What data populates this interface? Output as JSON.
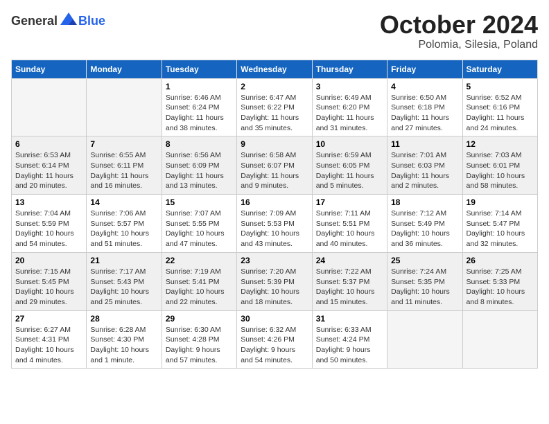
{
  "header": {
    "logo_general": "General",
    "logo_blue": "Blue",
    "month_title": "October 2024",
    "location": "Polomia, Silesia, Poland"
  },
  "weekdays": [
    "Sunday",
    "Monday",
    "Tuesday",
    "Wednesday",
    "Thursday",
    "Friday",
    "Saturday"
  ],
  "weeks": [
    [
      {
        "day": "",
        "empty": true
      },
      {
        "day": "",
        "empty": true
      },
      {
        "day": "1",
        "sunrise": "6:46 AM",
        "sunset": "6:24 PM",
        "daylight": "11 hours and 38 minutes."
      },
      {
        "day": "2",
        "sunrise": "6:47 AM",
        "sunset": "6:22 PM",
        "daylight": "11 hours and 35 minutes."
      },
      {
        "day": "3",
        "sunrise": "6:49 AM",
        "sunset": "6:20 PM",
        "daylight": "11 hours and 31 minutes."
      },
      {
        "day": "4",
        "sunrise": "6:50 AM",
        "sunset": "6:18 PM",
        "daylight": "11 hours and 27 minutes."
      },
      {
        "day": "5",
        "sunrise": "6:52 AM",
        "sunset": "6:16 PM",
        "daylight": "11 hours and 24 minutes."
      }
    ],
    [
      {
        "day": "6",
        "sunrise": "6:53 AM",
        "sunset": "6:14 PM",
        "daylight": "11 hours and 20 minutes."
      },
      {
        "day": "7",
        "sunrise": "6:55 AM",
        "sunset": "6:11 PM",
        "daylight": "11 hours and 16 minutes."
      },
      {
        "day": "8",
        "sunrise": "6:56 AM",
        "sunset": "6:09 PM",
        "daylight": "11 hours and 13 minutes."
      },
      {
        "day": "9",
        "sunrise": "6:58 AM",
        "sunset": "6:07 PM",
        "daylight": "11 hours and 9 minutes."
      },
      {
        "day": "10",
        "sunrise": "6:59 AM",
        "sunset": "6:05 PM",
        "daylight": "11 hours and 5 minutes."
      },
      {
        "day": "11",
        "sunrise": "7:01 AM",
        "sunset": "6:03 PM",
        "daylight": "11 hours and 2 minutes."
      },
      {
        "day": "12",
        "sunrise": "7:03 AM",
        "sunset": "6:01 PM",
        "daylight": "10 hours and 58 minutes."
      }
    ],
    [
      {
        "day": "13",
        "sunrise": "7:04 AM",
        "sunset": "5:59 PM",
        "daylight": "10 hours and 54 minutes."
      },
      {
        "day": "14",
        "sunrise": "7:06 AM",
        "sunset": "5:57 PM",
        "daylight": "10 hours and 51 minutes."
      },
      {
        "day": "15",
        "sunrise": "7:07 AM",
        "sunset": "5:55 PM",
        "daylight": "10 hours and 47 minutes."
      },
      {
        "day": "16",
        "sunrise": "7:09 AM",
        "sunset": "5:53 PM",
        "daylight": "10 hours and 43 minutes."
      },
      {
        "day": "17",
        "sunrise": "7:11 AM",
        "sunset": "5:51 PM",
        "daylight": "10 hours and 40 minutes."
      },
      {
        "day": "18",
        "sunrise": "7:12 AM",
        "sunset": "5:49 PM",
        "daylight": "10 hours and 36 minutes."
      },
      {
        "day": "19",
        "sunrise": "7:14 AM",
        "sunset": "5:47 PM",
        "daylight": "10 hours and 32 minutes."
      }
    ],
    [
      {
        "day": "20",
        "sunrise": "7:15 AM",
        "sunset": "5:45 PM",
        "daylight": "10 hours and 29 minutes."
      },
      {
        "day": "21",
        "sunrise": "7:17 AM",
        "sunset": "5:43 PM",
        "daylight": "10 hours and 25 minutes."
      },
      {
        "day": "22",
        "sunrise": "7:19 AM",
        "sunset": "5:41 PM",
        "daylight": "10 hours and 22 minutes."
      },
      {
        "day": "23",
        "sunrise": "7:20 AM",
        "sunset": "5:39 PM",
        "daylight": "10 hours and 18 minutes."
      },
      {
        "day": "24",
        "sunrise": "7:22 AM",
        "sunset": "5:37 PM",
        "daylight": "10 hours and 15 minutes."
      },
      {
        "day": "25",
        "sunrise": "7:24 AM",
        "sunset": "5:35 PM",
        "daylight": "10 hours and 11 minutes."
      },
      {
        "day": "26",
        "sunrise": "7:25 AM",
        "sunset": "5:33 PM",
        "daylight": "10 hours and 8 minutes."
      }
    ],
    [
      {
        "day": "27",
        "sunrise": "6:27 AM",
        "sunset": "4:31 PM",
        "daylight": "10 hours and 4 minutes."
      },
      {
        "day": "28",
        "sunrise": "6:28 AM",
        "sunset": "4:30 PM",
        "daylight": "10 hours and 1 minute."
      },
      {
        "day": "29",
        "sunrise": "6:30 AM",
        "sunset": "4:28 PM",
        "daylight": "9 hours and 57 minutes."
      },
      {
        "day": "30",
        "sunrise": "6:32 AM",
        "sunset": "4:26 PM",
        "daylight": "9 hours and 54 minutes."
      },
      {
        "day": "31",
        "sunrise": "6:33 AM",
        "sunset": "4:24 PM",
        "daylight": "9 hours and 50 minutes."
      },
      {
        "day": "",
        "empty": true
      },
      {
        "day": "",
        "empty": true
      }
    ]
  ]
}
